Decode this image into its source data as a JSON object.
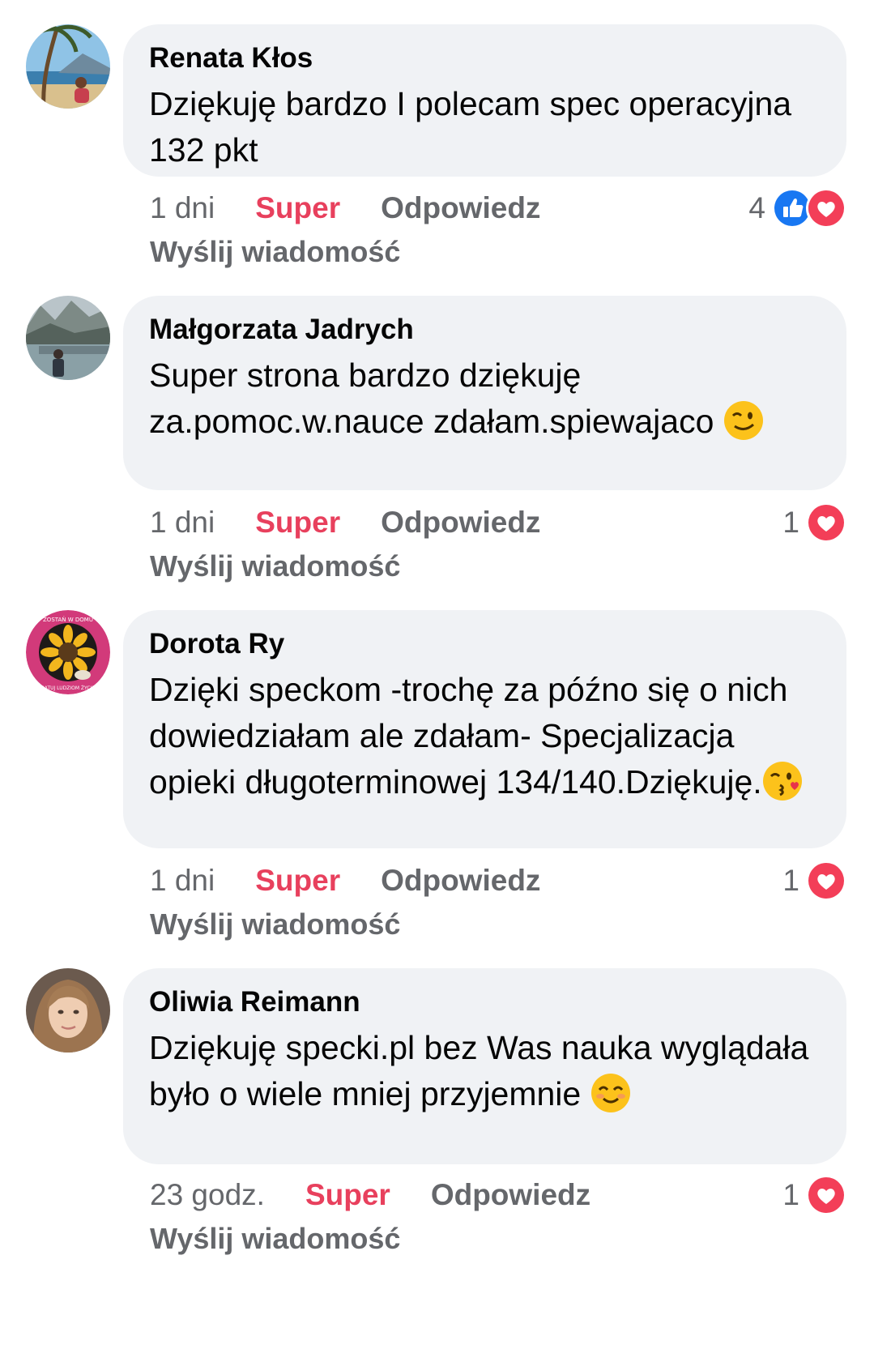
{
  "comments": [
    {
      "author": "Renata Kłos",
      "text": "Dziękuję bardzo I polecam spec operacyjna 132 pkt",
      "time": "1 dni",
      "super_label": "Super",
      "reply_label": "Odpowiedz",
      "send_label": "Wyślij wiadomość",
      "reaction_count": "4",
      "reactions": [
        "like-icon",
        "love-icon"
      ]
    },
    {
      "author": "Małgorzata Jadrych",
      "text": "Super strona bardzo dziękuję za.pomoc.w.nauce zdałam.spiewajaco",
      "emoji": "wink-emoji",
      "time": "1 dni",
      "super_label": "Super",
      "reply_label": "Odpowiedz",
      "send_label": "Wyślij wiadomość",
      "reaction_count": "1",
      "reactions": [
        "love-icon"
      ]
    },
    {
      "author": "Dorota Ry",
      "text": "Dzięki speckom -trochę za późno się o nich dowiedziałam ale zdałam- Specjalizacja opieki długoterminowej 134/140.Dziękuję.",
      "emoji": "kiss-emoji",
      "avatar_text": [
        "ZOSTAŃ W DOMU",
        "RATUJ LUDZIOM ŻYCIE"
      ],
      "time": "1 dni",
      "super_label": "Super",
      "reply_label": "Odpowiedz",
      "send_label": "Wyślij wiadomość",
      "reaction_count": "1",
      "reactions": [
        "love-icon"
      ]
    },
    {
      "author": "Oliwia Reimann",
      "text": "Dziękuję specki.pl bez Was nauka wyglądała było o wiele mniej przyjemnie",
      "emoji": "smile-emoji",
      "time": "23 godz.",
      "super_label": "Super",
      "reply_label": "Odpowiedz",
      "send_label": "Wyślij wiadomość",
      "reaction_count": "1",
      "reactions": [
        "love-icon"
      ]
    }
  ],
  "colors": {
    "bubble": "#f0f2f5",
    "super": "#e8405d",
    "meta": "#65676b",
    "like": "#1877f2",
    "love": "#f33e58"
  }
}
